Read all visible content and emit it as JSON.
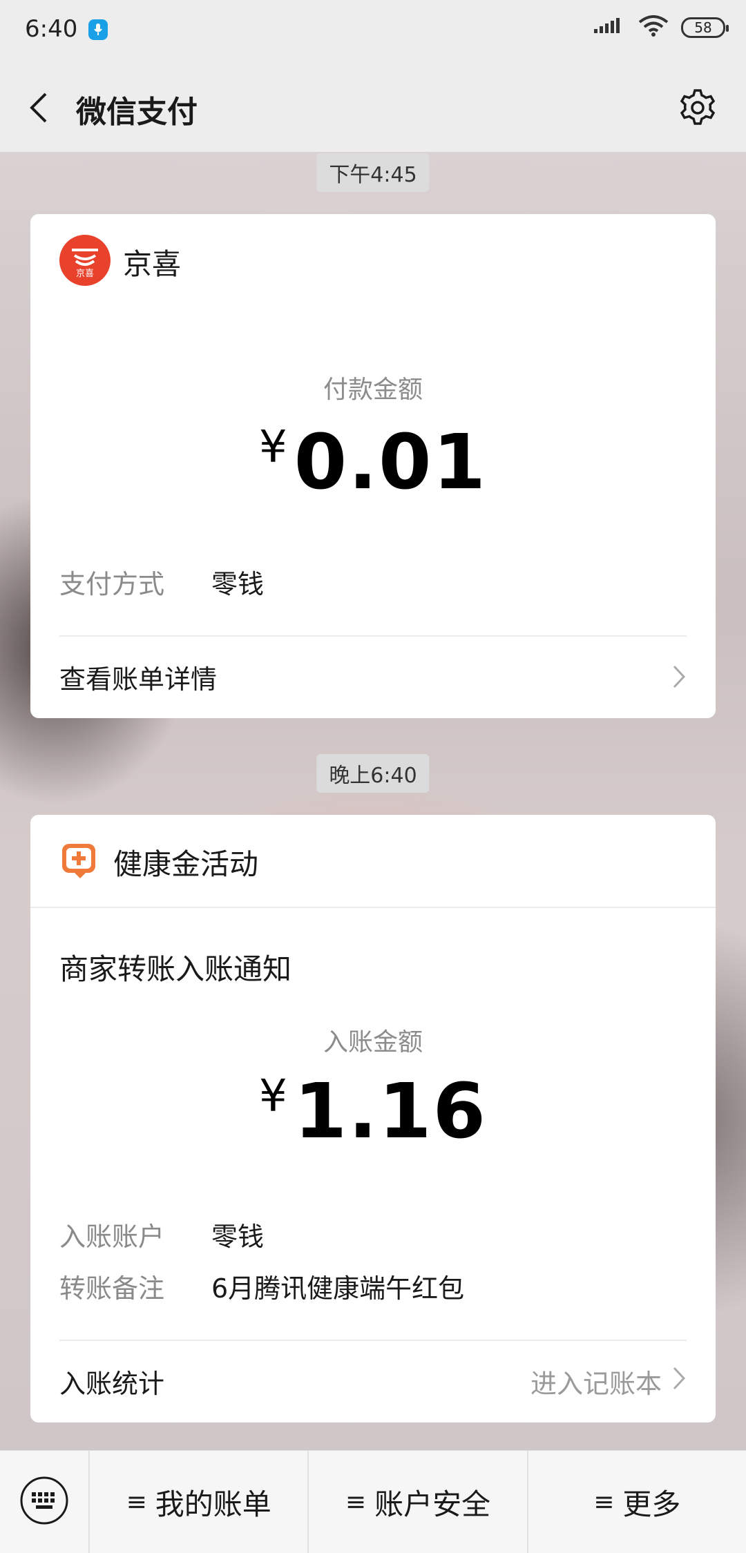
{
  "status_bar": {
    "time": "6:40",
    "battery": "58"
  },
  "header": {
    "title": "微信支付"
  },
  "messages": [
    {
      "timestamp": "下午4:45",
      "merchant": "京喜",
      "merchant_logo_text": "京喜",
      "amount_label": "付款金额",
      "currency": "¥",
      "amount": "0.01",
      "fields": [
        {
          "key": "支付方式",
          "value": "零钱"
        }
      ],
      "link_left": "查看账单详情"
    },
    {
      "timestamp": "晚上6:40",
      "merchant": "健康金活动",
      "subtitle": "商家转账入账通知",
      "amount_label": "入账金额",
      "currency": "¥",
      "amount": "1.16",
      "fields": [
        {
          "key": "入账账户",
          "value": "零钱"
        },
        {
          "key": "转账备注",
          "value": "6月腾讯健康端午红包"
        }
      ],
      "link_left": "入账统计",
      "link_right": "进入记账本"
    }
  ],
  "bottom_bar": {
    "tabs": [
      {
        "label": "我的账单"
      },
      {
        "label": "账户安全"
      },
      {
        "label": "更多"
      }
    ]
  },
  "colors": {
    "jingxi_red": "#e8412c",
    "health_orange": "#f07a3a"
  }
}
